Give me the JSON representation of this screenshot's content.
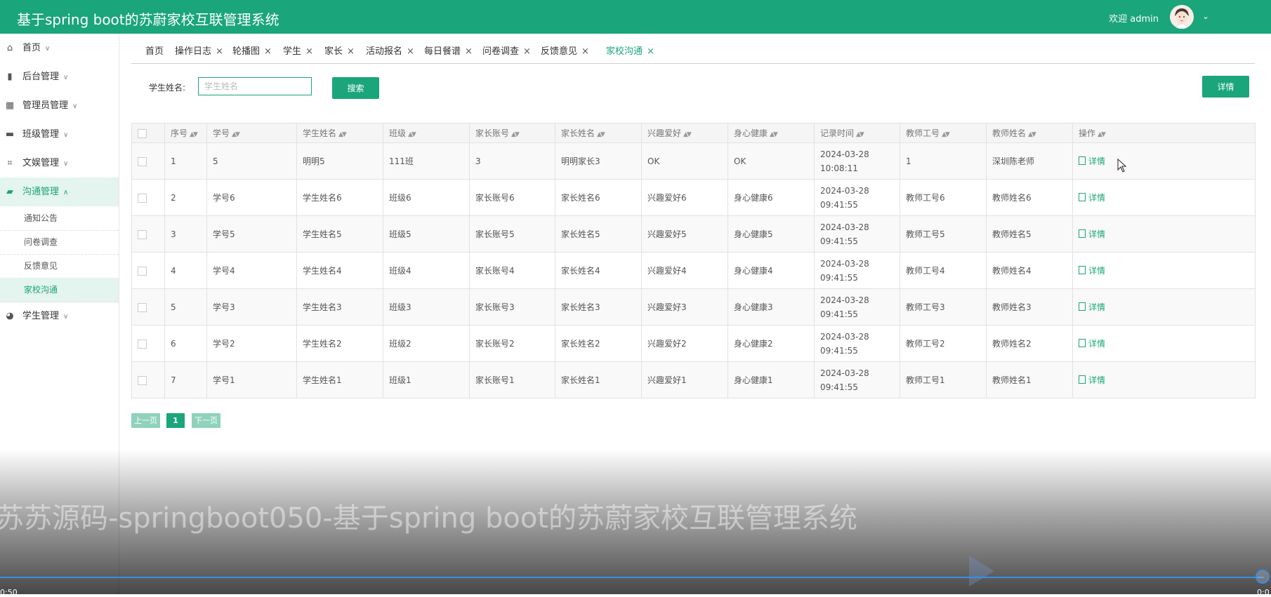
{
  "header": {
    "title": "基于spring boot的苏蔚家校互联管理系统",
    "welcome": "欢迎 admin"
  },
  "sidebar": {
    "menus": [
      {
        "label": "首页",
        "icon": "home-icon"
      },
      {
        "label": "后台管理",
        "icon": "book-icon"
      },
      {
        "label": "管理员管理",
        "icon": "layout-icon"
      },
      {
        "label": "班级管理",
        "icon": "card-icon"
      },
      {
        "label": "文娱管理",
        "icon": "crop-icon"
      },
      {
        "label": "沟通管理",
        "icon": "chat-icon"
      },
      {
        "label": "学生管理",
        "icon": "gauge-icon"
      }
    ],
    "submenus": [
      "通知公告",
      "问卷调查",
      "反馈意见",
      "家校沟通"
    ]
  },
  "tabs": [
    "首页",
    "操作日志",
    "轮播图",
    "学生",
    "家长",
    "活动报名",
    "每日餐谱",
    "问卷调查",
    "反馈意见",
    "家校沟通"
  ],
  "search": {
    "label": "学生姓名:",
    "placeholder": "学生姓名",
    "button": "搜索"
  },
  "toolbar": {
    "detail_button": "详情"
  },
  "table": {
    "columns": [
      "序号",
      "学号",
      "学生姓名",
      "班级",
      "家长账号",
      "家长姓名",
      "兴趣爱好",
      "身心健康",
      "记录时间",
      "教师工号",
      "教师姓名",
      "操作"
    ],
    "action_label": "详情",
    "rows": [
      [
        "1",
        "5",
        "明明5",
        "111班",
        "3",
        "明明家长3",
        "OK",
        "OK",
        "2024-03-28 10:08:11",
        "1",
        "深圳陈老师"
      ],
      [
        "2",
        "学号6",
        "学生姓名6",
        "班级6",
        "家长账号6",
        "家长姓名6",
        "兴趣爱好6",
        "身心健康6",
        "2024-03-28 09:41:55",
        "教师工号6",
        "教师姓名6"
      ],
      [
        "3",
        "学号5",
        "学生姓名5",
        "班级5",
        "家长账号5",
        "家长姓名5",
        "兴趣爱好5",
        "身心健康5",
        "2024-03-28 09:41:55",
        "教师工号5",
        "教师姓名5"
      ],
      [
        "4",
        "学号4",
        "学生姓名4",
        "班级4",
        "家长账号4",
        "家长姓名4",
        "兴趣爱好4",
        "身心健康4",
        "2024-03-28 09:41:55",
        "教师工号4",
        "教师姓名4"
      ],
      [
        "5",
        "学号3",
        "学生姓名3",
        "班级3",
        "家长账号3",
        "家长姓名3",
        "兴趣爱好3",
        "身心健康3",
        "2024-03-28 09:41:55",
        "教师工号3",
        "教师姓名3"
      ],
      [
        "6",
        "学号2",
        "学生姓名2",
        "班级2",
        "家长账号2",
        "家长姓名2",
        "兴趣爱好2",
        "身心健康2",
        "2024-03-28 09:41:55",
        "教师工号2",
        "教师姓名2"
      ],
      [
        "7",
        "学号1",
        "学生姓名1",
        "班级1",
        "家长账号1",
        "家长姓名1",
        "兴趣爱好1",
        "身心健康1",
        "2024-03-28 09:41:55",
        "教师工号1",
        "教师姓名1"
      ]
    ]
  },
  "pagination": {
    "prev": "上一页",
    "current": "1",
    "next": "下一页"
  },
  "video": {
    "watermark": "苏苏源码-springboot050-基于spring boot的苏蔚家校互联管理系统",
    "time_left": "0:50",
    "time_right": "0:0"
  },
  "colors": {
    "brand": "#1aa57a",
    "active_bg": "#e4f4ee",
    "progress": "#3a8ee6"
  }
}
